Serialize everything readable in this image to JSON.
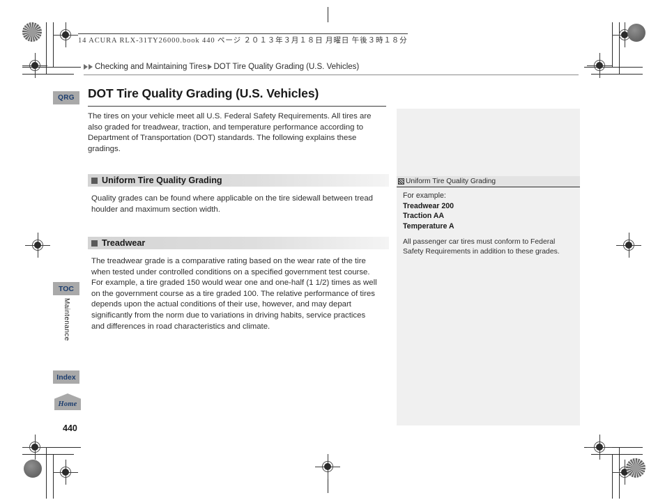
{
  "print_header": {
    "text": "14 ACURA RLX-31TY26000.book   440 ページ   ２０１３年３月１８日   月曜日   午後３時１８分"
  },
  "breadcrumb": {
    "level1": "Checking and Maintaining Tires",
    "level2": "DOT Tire Quality Grading (U.S. Vehicles)"
  },
  "title_block": {
    "badge": "QRG",
    "title": "DOT Tire Quality Grading (U.S. Vehicles)"
  },
  "main": {
    "lead_paragraph": "The tires on your vehicle meet all U.S. Federal Safety Requirements. All tires are also  graded for treadwear, traction, and temperature performance according to Department of Transportation (DOT) standards. The following explains these gradings.",
    "sections": [
      {
        "heading": "Uniform Tire Quality Grading",
        "body": "Quality grades can be found where applicable on the tire sidewall between tread houlder and maximum section width."
      },
      {
        "heading": "Treadwear",
        "body": "The treadwear grade is a comparative rating based on the wear rate of the tire when tested under controlled conditions on a specified government test course. For example, a tire graded 150 would wear one and one-half (1 1/2) times as well on the government course as a tire graded 100. The relative performance of tires depends upon the actual conditions of their use, however, and may depart significantly from the norm due to variations in driving habits, service practices and differences in road characteristics and climate."
      }
    ]
  },
  "side_note": {
    "heading": "Uniform Tire Quality Grading",
    "example_label": "For example:",
    "items": [
      "Treadwear 200",
      "Traction AA",
      "Temperature A"
    ],
    "footnote": "All passenger car tires must conform to Federal Safety Requirements in addition to these grades."
  },
  "nav": {
    "toc": "TOC",
    "chapter": "Maintenance",
    "index": "Index",
    "home": "Home"
  },
  "footer": {
    "page_number": "440"
  },
  "colors": {
    "badge_bg": "#a9a9a9",
    "badge_text": "#1c3d6e",
    "section_head_bg": "#d4d4d4",
    "side_panel_bg": "#f0f0f0"
  }
}
